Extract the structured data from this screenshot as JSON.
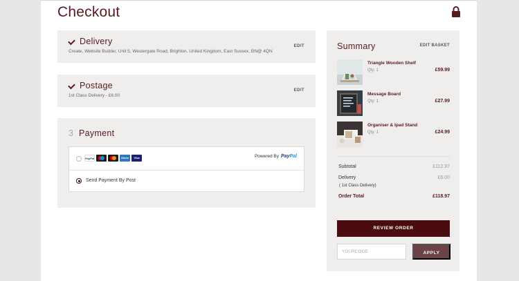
{
  "header": {
    "title": "Checkout"
  },
  "delivery": {
    "heading": "Delivery",
    "address": "Create, Website Builder, Unit 5, Westergate Road, Brighton, United Kingdom, East Sussex, BN@ 4QN",
    "edit_label": "EDIT"
  },
  "postage": {
    "heading": "Postage",
    "detail": "1st Class Delivery - £6.00",
    "edit_label": "EDIT"
  },
  "payment": {
    "step_number": "3",
    "heading": "Payment",
    "cards": [
      "PayPal",
      "Maestro",
      "Mastercard",
      "Amex",
      "Visa"
    ],
    "powered_by": "Powered By",
    "paypal_logo": [
      "Pay",
      "Pal"
    ],
    "post_option_label": "Send Payment By Post",
    "selected_option": "post"
  },
  "summary": {
    "title": "Summary",
    "edit_label": "EDIT BASKET",
    "items": [
      {
        "name": "Triangle Wooden Shelf",
        "qty": "Qty: 1",
        "price": "£59.99"
      },
      {
        "name": "Message Board",
        "qty": "Qty: 1",
        "price": "£27.99"
      },
      {
        "name": "Organiser & Ipad Stand",
        "qty": "Qty: 1",
        "price": "£24.99"
      }
    ],
    "subtotal_label": "Subtotal",
    "subtotal_value": "£112.97",
    "delivery_label": "Delivery",
    "delivery_value": "£6.00",
    "delivery_note": "( 1st Class Delivery)",
    "order_total_label": "Order Total",
    "order_total_value": "£118.97",
    "review_label": "REVIEW ORDER",
    "code_placeholder": "YOURCODE",
    "apply_label": "APPLY"
  },
  "colors": {
    "brand": "#5a1a1e",
    "button": "#4a0c0e",
    "apply": "#6b4245",
    "panel": "#efeeed"
  }
}
